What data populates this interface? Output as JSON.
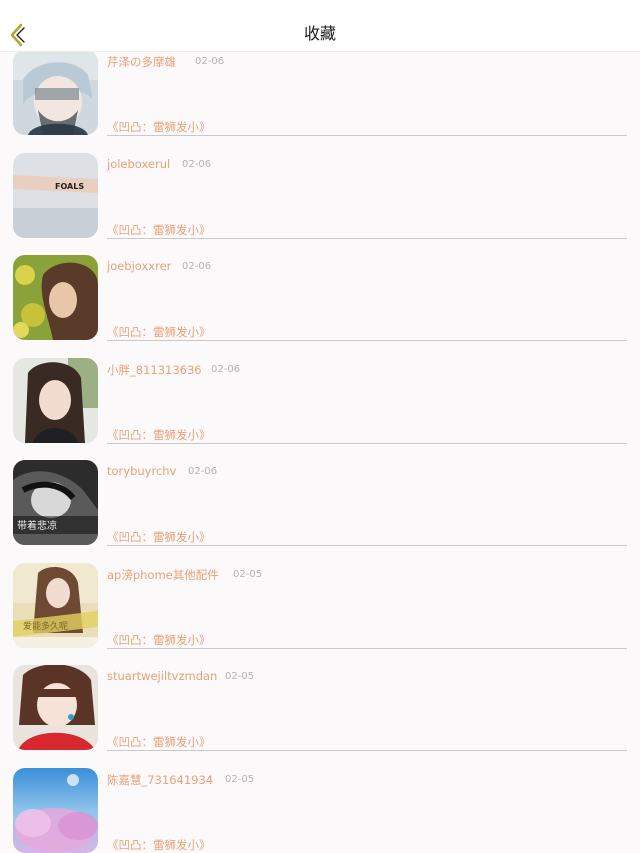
{
  "nav": {
    "title": "收藏",
    "back_icon": "chevron-left-icon",
    "accent_color": "#b8a32a"
  },
  "favorites": [
    {
      "name": "芹泽の多摩雄",
      "date": "02-06",
      "work": "《凹凸：雷狮发小》"
    },
    {
      "name": "joleboxerul",
      "date": "02-06",
      "work": "《凹凸：雷狮发小》"
    },
    {
      "name": "joebjoxxrer",
      "date": "02-06",
      "work": "《凹凸：雷狮发小》"
    },
    {
      "name": "小胖_811313636",
      "date": "02-06",
      "work": "《凹凸：雷狮发小》"
    },
    {
      "name": "torybuyrchv",
      "date": "02-06",
      "work": "《凹凸：雷狮发小》"
    },
    {
      "name": "ap滂phome其他配件",
      "date": "02-05",
      "work": "《凹凸：雷狮发小》"
    },
    {
      "name": "stuartwejiltvzmdan",
      "date": "02-05",
      "work": "《凹凸：雷狮发小》"
    },
    {
      "name": "陈嘉慧_731641934",
      "date": "02-05",
      "work": "《凹凸：雷狮发小》"
    }
  ],
  "avatar_overlays": {
    "row1": "FOALS",
    "row4": "带着悲凉",
    "row5": "爱能多久呢"
  },
  "colors": {
    "username": "#e8a178",
    "date": "#b3b3b3",
    "title": "#1a1a1a",
    "background": "#fbf9fa"
  }
}
